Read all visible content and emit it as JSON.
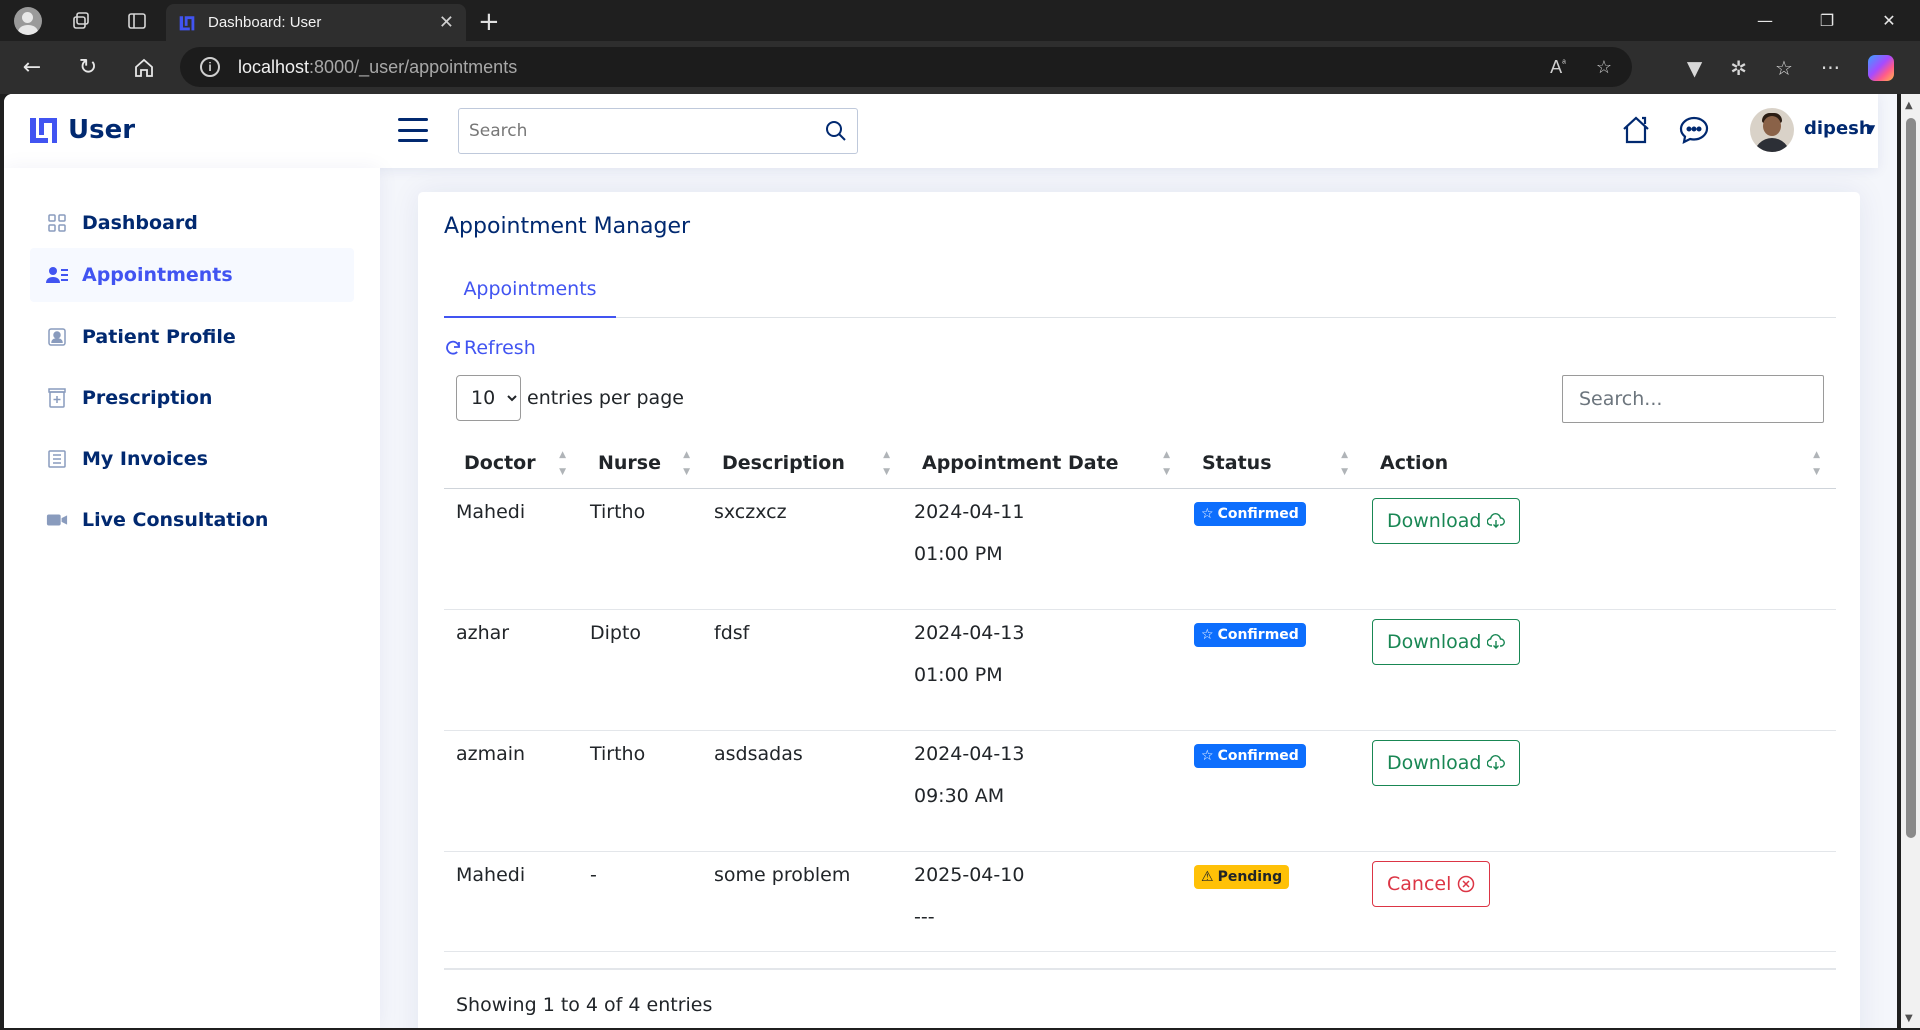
{
  "browser": {
    "tab_title": "Dashboard: User",
    "url_host": "localhost",
    "url_path": ":8000/_user/appointments"
  },
  "header": {
    "logo_text": "User",
    "search_placeholder": "Search",
    "user_name": "dipesh"
  },
  "sidebar": {
    "items": [
      {
        "label": "Dashboard",
        "icon": "grid-icon"
      },
      {
        "label": "Appointments",
        "icon": "people-list-icon"
      },
      {
        "label": "Patient Profile",
        "icon": "person-badge-icon"
      },
      {
        "label": "Prescription",
        "icon": "prescription-icon"
      },
      {
        "label": "My Invoices",
        "icon": "invoice-icon"
      },
      {
        "label": "Live Consultation",
        "icon": "video-camera-icon"
      }
    ],
    "active_index": 1
  },
  "main": {
    "title": "Appointment Manager",
    "tab_label": "Appointments",
    "refresh_label": "Refresh",
    "per_page_value": "10",
    "per_page_label": "entries per page",
    "table_search_placeholder": "Search...",
    "columns": [
      "Doctor",
      "Nurse",
      "Description",
      "Appointment Date",
      "Status",
      "Action"
    ],
    "rows": [
      {
        "doctor": "Mahedi",
        "nurse": "Tirtho",
        "description": "sxczxcz",
        "date": "2024-04-11",
        "time": "01:00 PM",
        "status": "Confirmed",
        "action": "Download"
      },
      {
        "doctor": "azhar",
        "nurse": "Dipto",
        "description": "fdsf",
        "date": "2024-04-13",
        "time": "01:00 PM",
        "status": "Confirmed",
        "action": "Download"
      },
      {
        "doctor": "azmain",
        "nurse": "Tirtho",
        "description": "asdsadas",
        "date": "2024-04-13",
        "time": "09:30 AM",
        "status": "Confirmed",
        "action": "Download"
      },
      {
        "doctor": "Mahedi",
        "nurse": "-",
        "description": "some problem",
        "date": "2025-04-10",
        "time": "---",
        "status": "Pending",
        "action": "Cancel"
      }
    ],
    "showing_text": "Showing 1 to 4 of 4 entries"
  },
  "colors": {
    "brand_navy": "#012970",
    "accent_blue": "#4154f1",
    "confirmed_badge": "#0d6efd",
    "pending_badge": "#ffc107",
    "download_green": "#198754",
    "cancel_red": "#dc3545"
  }
}
